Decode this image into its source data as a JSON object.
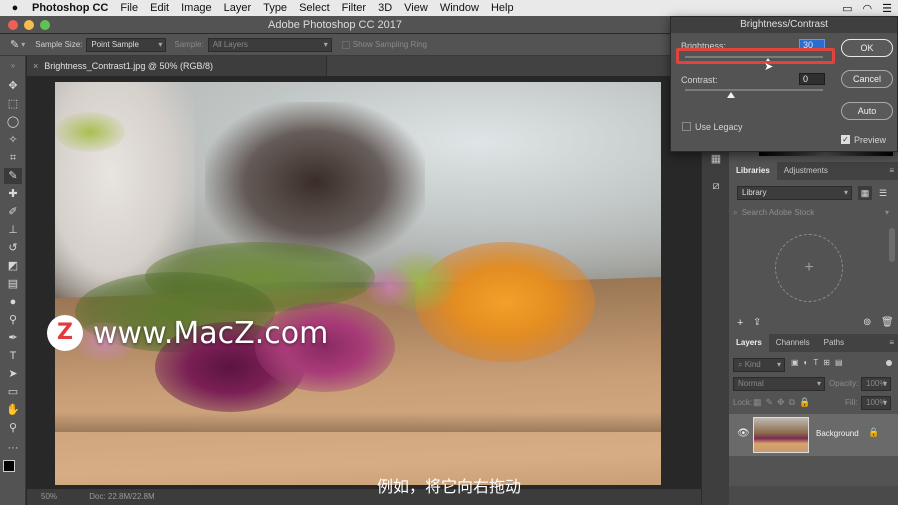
{
  "menubar": {
    "app": "Photoshop CC",
    "items": [
      "File",
      "Edit",
      "Image",
      "Layer",
      "Type",
      "Select",
      "Filter",
      "3D",
      "View",
      "Window",
      "Help"
    ]
  },
  "window": {
    "title": "Adobe Photoshop CC 2017"
  },
  "options_bar": {
    "sample_size_label": "Sample Size:",
    "sample_size_value": "Point Sample",
    "sample_label": "Sample:",
    "sample_value": "All Layers",
    "show_sampling_ring": "Show Sampling Ring"
  },
  "document": {
    "tab_title": "Brightness_Contrast1.jpg @ 50% (RGB/8)",
    "zoom": "50%",
    "doc_info": "Doc: 22.8M/22.8M"
  },
  "dialog": {
    "title": "Brightness/Contrast",
    "brightness_label": "Brightness:",
    "brightness_value": "30",
    "brightness_level": 30,
    "contrast_label": "Contrast:",
    "contrast_value": "0",
    "contrast_level": 0,
    "use_legacy_label": "Use Legacy",
    "use_legacy_checked": false,
    "ok_label": "OK",
    "cancel_label": "Cancel",
    "auto_label": "Auto",
    "preview_label": "Preview",
    "preview_checked": true
  },
  "libraries_panel": {
    "tabs": [
      "Libraries",
      "Adjustments"
    ],
    "library_select": "Library",
    "search_placeholder": "Search Adobe Stock"
  },
  "layers_panel": {
    "tabs": [
      "Layers",
      "Channels",
      "Paths"
    ],
    "kind_label": "Kind",
    "blend_mode": "Normal",
    "opacity_label": "Opacity:",
    "opacity_value": "100%",
    "lock_label": "Lock:",
    "fill_label": "Fill:",
    "fill_value": "100%",
    "layer_name": "Background"
  },
  "watermark": {
    "logo_letter": "Z",
    "text": "www.MacZ.com"
  },
  "subtitle": "例如，将它向右拖动",
  "colors": {
    "highlight": "#e0443d",
    "panel": "#535353",
    "dark": "#3c3c3c"
  }
}
